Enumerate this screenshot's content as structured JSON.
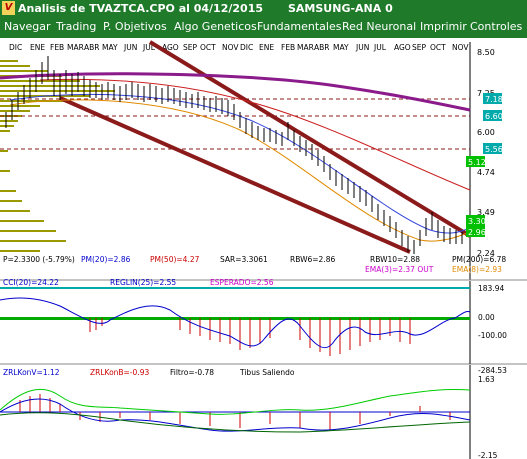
{
  "window": {
    "title": "Analisis de TVAZTCA.CPO al 04/12/2015",
    "symbol_title": "SAMSUNG-ANA 0"
  },
  "menu": [
    "Navegar",
    "Trading",
    "P. Objetivos",
    "Algo Geneticos",
    "Fundamentales",
    "Red Neuronal",
    "Imprimir",
    "Controles"
  ],
  "months": [
    "DIC",
    "ENE",
    "FEB",
    "MAR",
    "ABR",
    "MAY",
    "JUN",
    "JUL",
    "AGO",
    "SEP",
    "OCT",
    "NOV",
    "DIC",
    "ENE",
    "FEB",
    "MAR",
    "ABR",
    "MAY",
    "JUN",
    "JUL",
    "AGO",
    "SEP",
    "OCT",
    "NOV"
  ],
  "price_axis": [
    "8.50",
    "7.25",
    "6.00",
    "4.74",
    "3.49",
    "2.24"
  ],
  "price_boxes": [
    {
      "label": "7.18",
      "bg": "#00aaaa",
      "fg": "#ffffff"
    },
    {
      "label": "6.60",
      "bg": "#00aaaa",
      "fg": "#ffffff"
    },
    {
      "label": "5.56",
      "bg": "#00aaaa",
      "fg": "#ffffff"
    },
    {
      "label": "5.12",
      "bg": "#00c000",
      "fg": "#ffffff"
    },
    {
      "label": "3.30",
      "bg": "#00c000",
      "fg": "#ffffff"
    },
    {
      "label": "2.96",
      "bg": "#00c000",
      "fg": "#ffffff"
    }
  ],
  "price_info": {
    "p": "P=2.3300 (-5.79%)",
    "pm20": "PM(20)=2.86",
    "pm50": "PM(50)=4.27",
    "sar": "SAR=3.3061",
    "rbw6": "RBW6=2.86",
    "rbw10": "RBW10=2.88",
    "pm200": "PM(200)=6.78",
    "ema3": "EMA(3)=2.37 OUT",
    "ema8": "EMA(8)=2.93"
  },
  "osc1": {
    "cci": "CCI(20)=24.22",
    "reglin": "REGLIN(25)=2.55",
    "esperado": "ESPERADO=2.56",
    "axis": [
      "183.94",
      "0.00",
      "-100.00",
      "-284.53"
    ]
  },
  "osc2": {
    "zrlk_v": "ZRLKonV=1.12",
    "zrlk_b": "ZRLKonB=-0.93",
    "filtro": "Filtro=-0.78",
    "tibus": "Tibus Saliendo",
    "axis": [
      "1.63",
      "-2.15"
    ]
  },
  "colors": {
    "titlebar": "#1f7a2a",
    "menubar": "#1f7a2a",
    "channel": "#8b1a1a",
    "ma_purple": "#8b1a8b"
  }
}
